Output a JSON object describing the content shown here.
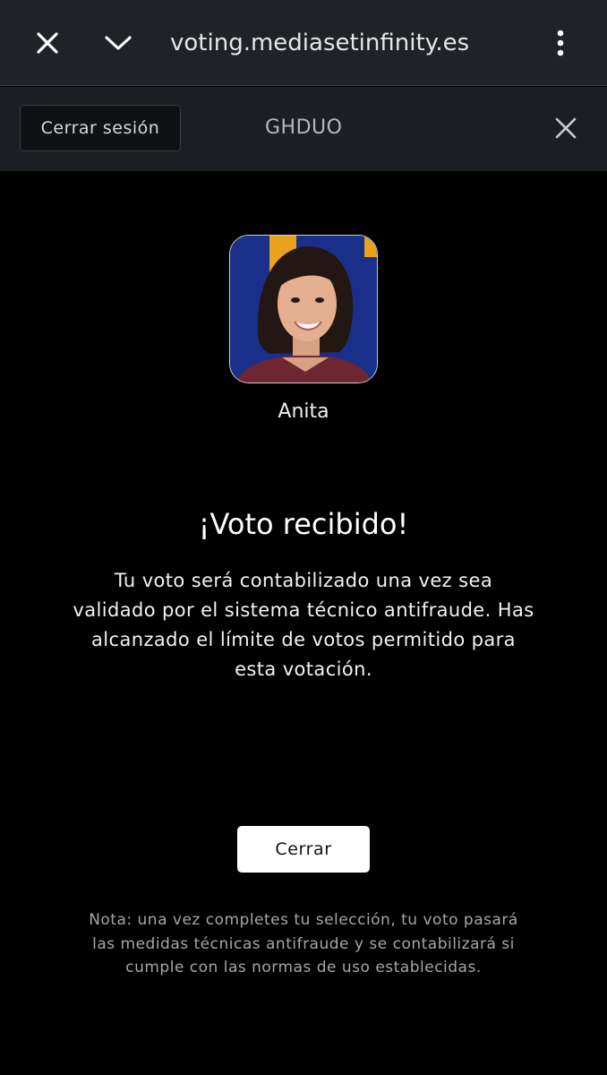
{
  "browser": {
    "url": "voting.mediasetinfinity.es",
    "icons": {
      "close": "close-icon",
      "collapse": "chevron-down-icon",
      "menu": "more-vert-icon"
    }
  },
  "header": {
    "logout_label": "Cerrar sesión",
    "program": "GHDUO",
    "close_icon": "close-icon"
  },
  "candidate": {
    "name": "Anita",
    "photo_background": "#1a2f8a",
    "photo_accent": "#e8a21b"
  },
  "confirmation": {
    "title": "¡Voto recibido!",
    "message": "Tu voto será contabilizado una vez sea validado por el sistema técnico antifraude. Has alcanzado el límite de votos permitido para esta votación.",
    "close_label": "Cerrar",
    "note": "Nota: una vez completes tu selección, tu voto pasará las medidas técnicas antifraude y se contabilizará si cumple con las normas de uso establecidas."
  },
  "colors": {
    "page_background": "#000000",
    "browser_bar": "#1f2226",
    "header_bar": "#1b1e22",
    "button_background": "#ffffff"
  }
}
